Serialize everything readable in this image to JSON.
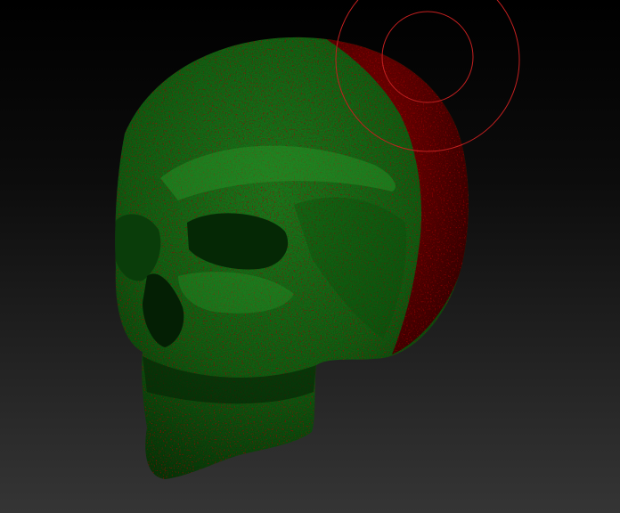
{
  "canvas": {
    "background_top": "#000000",
    "background_bottom": "#333333"
  },
  "model": {
    "name": "skull",
    "masked_color": "#1b7a1b",
    "unmasked_color": "#8a0000",
    "shadow_color": "#062806"
  },
  "brush_cursor": {
    "icon": "brush-circle-icon",
    "color": "#c42020"
  }
}
